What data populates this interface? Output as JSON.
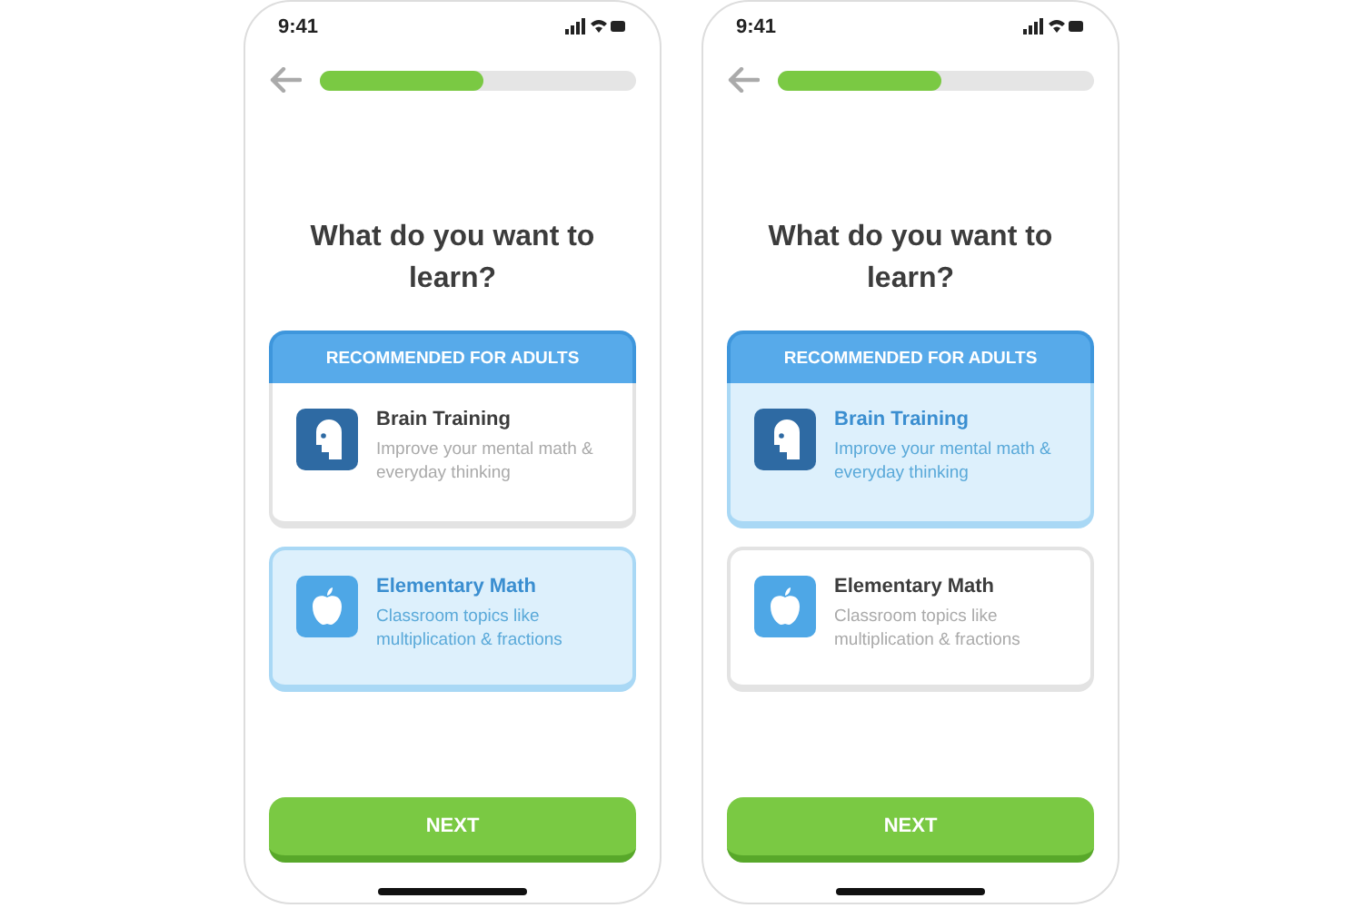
{
  "phones": [
    {
      "time": "9:41",
      "progress": {
        "level": 0.52
      },
      "title": "What do you want to learn?",
      "group_label": "RECOMMENDED FOR ADULTS",
      "options": [
        {
          "kind": "head",
          "title": "Brain Training",
          "description": "Improve your mental math & everyday thinking",
          "selected": false
        },
        {
          "kind": "apple",
          "title": "Elementary Math",
          "description": "Classroom topics like multiplication & fractions",
          "selected": true
        }
      ],
      "button": "NEXT"
    },
    {
      "time": "9:41",
      "progress": {
        "level": 0.52
      },
      "title": "What do you want to learn?",
      "group_label": "RECOMMENDED FOR ADULTS",
      "options": [
        {
          "kind": "head",
          "title": "Brain Training",
          "description": "Improve your mental math & everyday thinking",
          "selected": true
        },
        {
          "kind": "apple",
          "title": "Elementary Math",
          "description": "Classroom topics like multiplication & fractions",
          "selected": false
        }
      ],
      "button": "NEXT"
    }
  ]
}
